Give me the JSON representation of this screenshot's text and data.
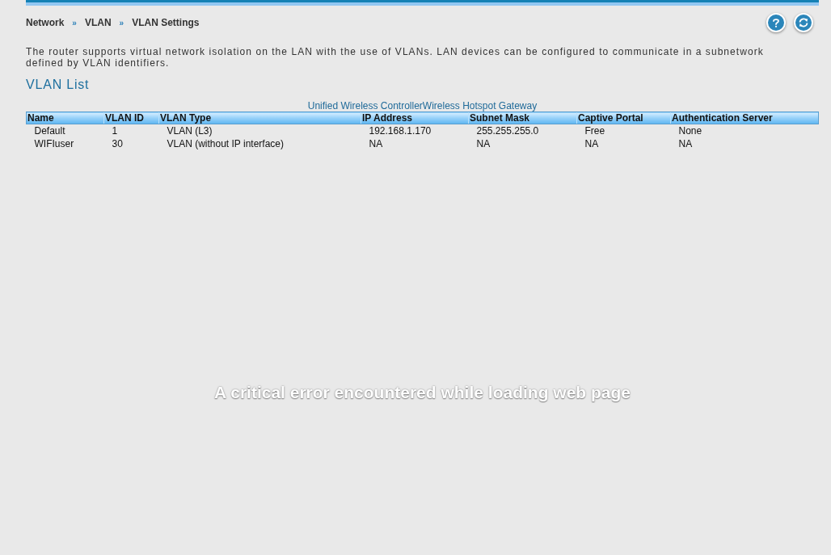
{
  "breadcrumb": [
    {
      "kind": "link",
      "text": "Network"
    },
    {
      "kind": "separator",
      "text": "»"
    },
    {
      "kind": "link",
      "text": "VLAN"
    },
    {
      "kind": "separator",
      "text": "»"
    },
    {
      "kind": "current",
      "text": "VLAN Settings"
    }
  ],
  "description": "The router supports virtual network isolation on the LAN with the use of VLANs. LAN devices can be configured to communicate in a subnetwork defined by VLAN identifiers.",
  "section_title": "VLAN List",
  "table": {
    "caption": "Unified Wireless ControllerWireless Hotspot Gateway",
    "columns": [
      "Name",
      "VLAN ID",
      "VLAN Type",
      "IP Address",
      "Subnet Mask",
      "Captive Portal",
      "Authentication Server"
    ],
    "rows": [
      [
        "Default",
        "1",
        "VLAN (L3)",
        "192.168.1.170",
        "255.255.255.0",
        "Free",
        "None"
      ],
      [
        "WIFIuser",
        "30",
        "VLAN (without IP interface)",
        "NA",
        "NA",
        "NA",
        "NA"
      ]
    ]
  },
  "error_message": "A critical error encountered while loading web page"
}
